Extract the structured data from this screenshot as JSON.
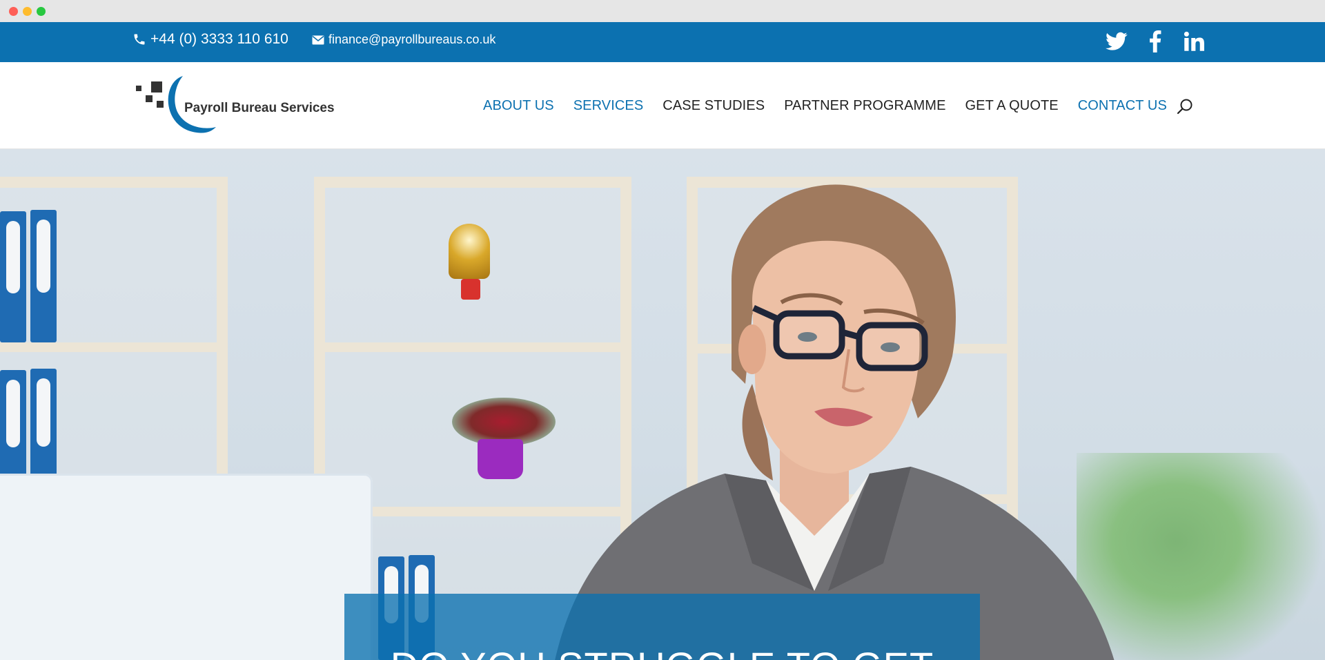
{
  "topbar": {
    "phone": "+44 (0) 3333 110 610",
    "email": "finance@payrollbureaus.co.uk",
    "socials": [
      "twitter-icon",
      "facebook-icon",
      "linkedin-icon"
    ]
  },
  "brand": {
    "name": "Payroll Bureau Services",
    "color": "#0c71b0"
  },
  "nav": {
    "items": [
      {
        "label": "ABOUT US",
        "active": true
      },
      {
        "label": "SERVICES",
        "active": true
      },
      {
        "label": "CASE STUDIES",
        "active": false
      },
      {
        "label": "PARTNER PROGRAMME",
        "active": false
      },
      {
        "label": "GET A QUOTE",
        "active": false
      },
      {
        "label": "CONTACT US",
        "active": true
      }
    ],
    "search_icon": "search-icon"
  },
  "hero": {
    "title": "DO YOU STRUGGLE TO GET"
  }
}
